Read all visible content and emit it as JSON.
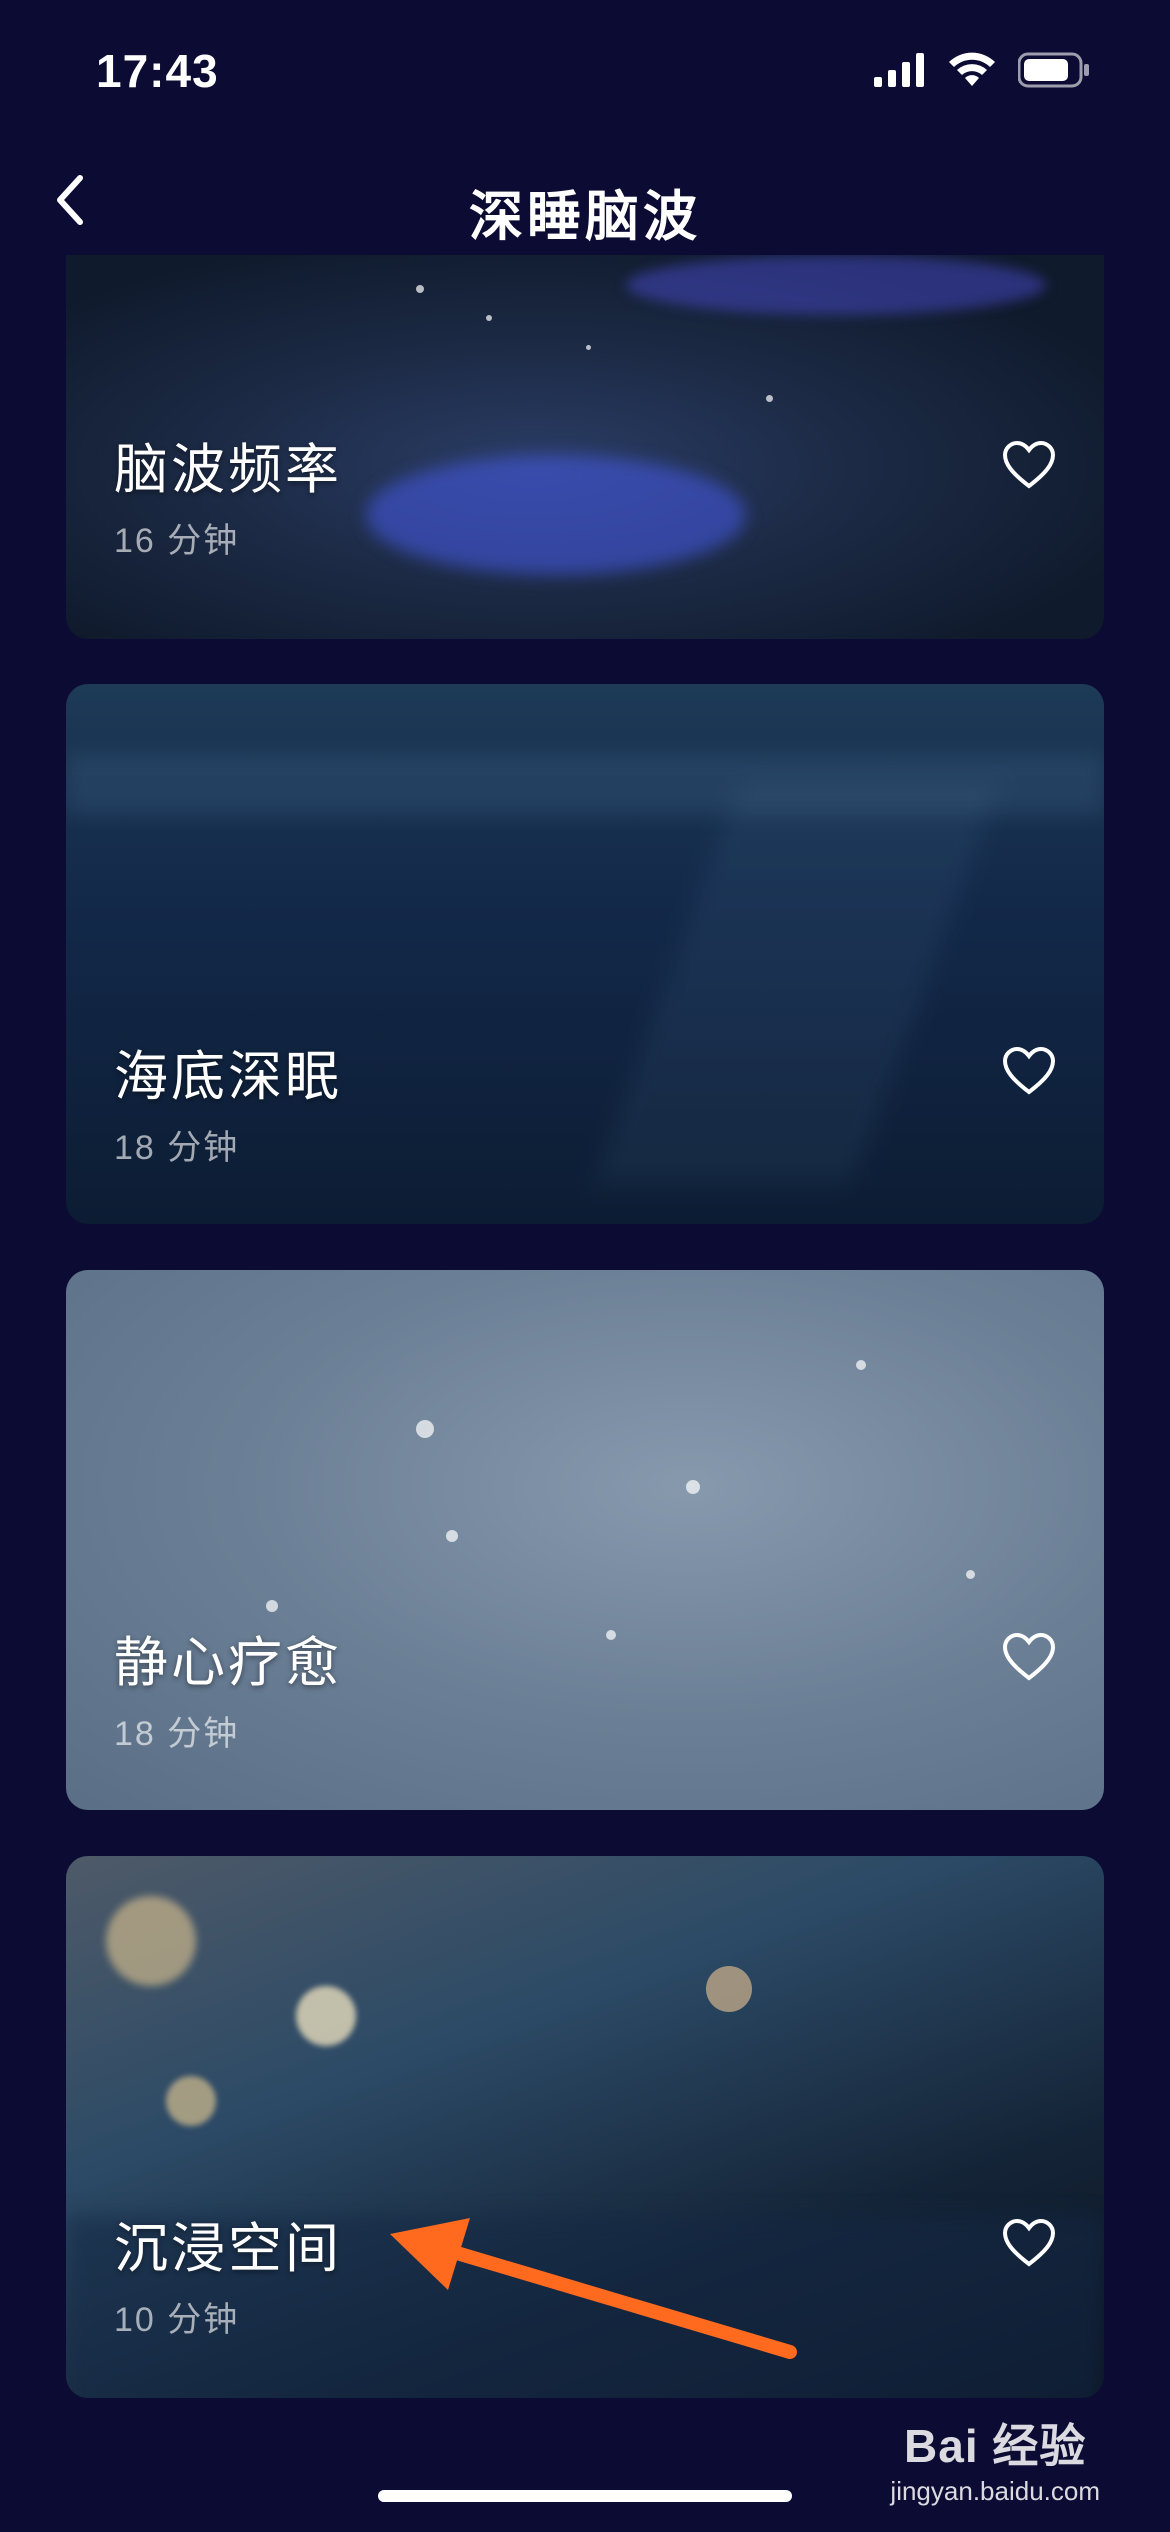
{
  "status": {
    "time": "17:43"
  },
  "nav": {
    "title": "深睡脑波"
  },
  "cards": [
    {
      "title": "脑波频率",
      "duration": "16 分钟"
    },
    {
      "title": "海底深眠",
      "duration": "18 分钟"
    },
    {
      "title": "静心疗愈",
      "duration": "18 分钟"
    },
    {
      "title": "沉浸空间",
      "duration": "10 分钟"
    }
  ],
  "watermark": {
    "logo": "Bai 经验",
    "url": "jingyan.baidu.com"
  },
  "annotation": {
    "arrow_color": "#ff6a1f"
  }
}
